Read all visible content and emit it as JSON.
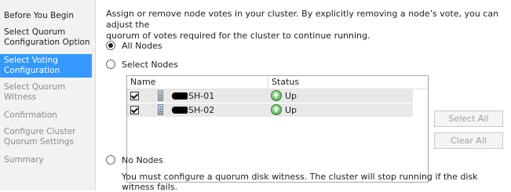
{
  "sidebar": {
    "items": [
      {
        "label_lines": [
          "Before You Begin"
        ],
        "state": "enabled"
      },
      {
        "label_lines": [
          "Select Quorum",
          "Configuration Option"
        ],
        "state": "enabled"
      },
      {
        "label_lines": [
          "Select Voting",
          "Configuration"
        ],
        "state": "selected"
      },
      {
        "label_lines": [
          "Select Quorum",
          "Witness"
        ],
        "state": "disabled"
      },
      {
        "label_lines": [
          "Confirmation"
        ],
        "state": "disabled"
      },
      {
        "label_lines": [
          "Configure Cluster",
          "Quorum Settings"
        ],
        "state": "disabled"
      },
      {
        "label_lines": [
          "Summary"
        ],
        "state": "disabled"
      }
    ]
  },
  "main": {
    "description_lines": [
      "Assign or remove node votes in your cluster. By explicitly removing a node’s vote, you can adjust the",
      "quorum of votes required for the cluster to continue running."
    ],
    "options": {
      "all_nodes": {
        "label": "All Nodes",
        "selected": true
      },
      "select_nodes": {
        "label": "Select Nodes",
        "selected": false
      },
      "no_nodes": {
        "label": "No Nodes",
        "selected": false
      }
    },
    "node_list": {
      "columns": [
        "Name",
        "Status"
      ],
      "rows": [
        {
          "name": "SH-01",
          "status": "Up",
          "checked": true
        },
        {
          "name": "SH-02",
          "status": "Up",
          "checked": true
        }
      ]
    },
    "buttons": {
      "select_all": "Select All",
      "clear_all": "Clear All"
    },
    "no_nodes_note": "You must configure a quorum disk witness. The cluster will stop running if the disk witness fails."
  },
  "colors": {
    "selection": "#3399ff",
    "status_up": "#3ca53a",
    "disabled_text": "#8a8a8a"
  }
}
